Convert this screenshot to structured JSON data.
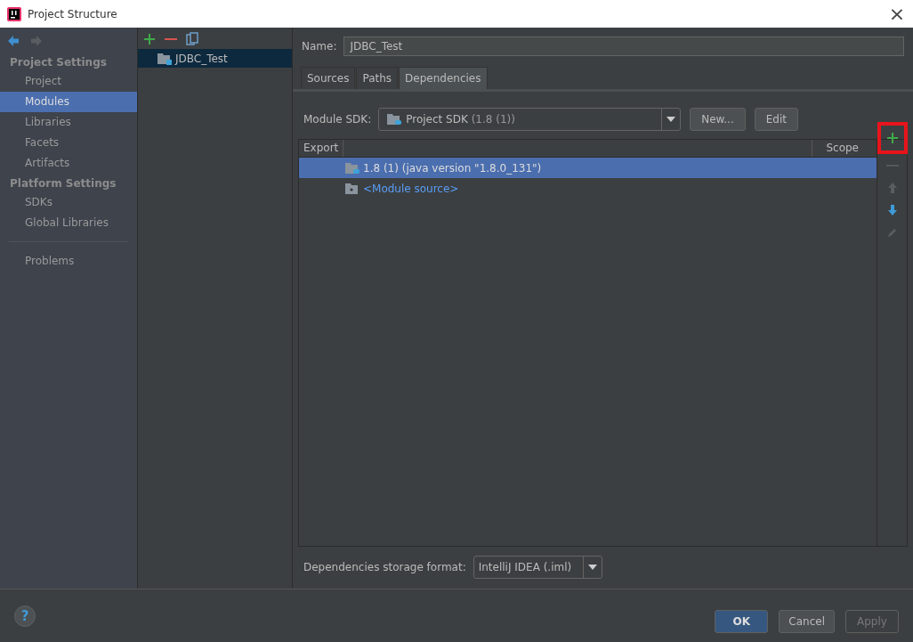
{
  "window": {
    "title": "Project Structure",
    "close": "×"
  },
  "sidebar": {
    "sections": [
      {
        "title": "Project Settings",
        "items": [
          {
            "label": "Project",
            "selected": false
          },
          {
            "label": "Modules",
            "selected": true
          },
          {
            "label": "Libraries",
            "selected": false
          },
          {
            "label": "Facets",
            "selected": false
          },
          {
            "label": "Artifacts",
            "selected": false
          }
        ]
      },
      {
        "title": "Platform Settings",
        "items": [
          {
            "label": "SDKs",
            "selected": false
          },
          {
            "label": "Global Libraries",
            "selected": false
          }
        ]
      }
    ],
    "footer_items": [
      {
        "label": "Problems",
        "selected": false
      }
    ]
  },
  "modules": {
    "items": [
      {
        "label": "JDBC_Test",
        "selected": true
      }
    ]
  },
  "name_field": {
    "label": "Name:",
    "value": "JDBC_Test"
  },
  "tabs": [
    {
      "label": "Sources",
      "selected": false
    },
    {
      "label": "Paths",
      "selected": false
    },
    {
      "label": "Dependencies",
      "selected": true
    }
  ],
  "module_sdk": {
    "label": "Module SDK:",
    "value": "Project SDK",
    "detail": "(1.8 (1))",
    "buttons": [
      "New...",
      "Edit"
    ]
  },
  "table": {
    "columns": [
      "Export",
      "Scope"
    ],
    "rows": [
      {
        "kind": "sdk",
        "label": "1.8 (1) (java version \"1.8.0_131\")",
        "selected": true
      },
      {
        "kind": "source",
        "label": "<Module source>",
        "selected": false
      }
    ]
  },
  "table_toolbar": [
    {
      "kind": "add",
      "disabled": false,
      "highlighted": true
    },
    {
      "kind": "remove",
      "disabled": true,
      "highlighted": false
    },
    {
      "kind": "up",
      "disabled": true,
      "highlighted": false
    },
    {
      "kind": "down",
      "disabled": false,
      "highlighted": false
    },
    {
      "kind": "edit",
      "disabled": true,
      "highlighted": false
    }
  ],
  "storage_format": {
    "label": "Dependencies storage format:",
    "value": "IntelliJ IDEA (.iml)"
  },
  "footer_buttons": [
    {
      "label": "OK",
      "kind": "default",
      "disabled": false
    },
    {
      "label": "Cancel",
      "kind": "normal",
      "disabled": false
    },
    {
      "label": "Apply",
      "kind": "normal",
      "disabled": true
    }
  ],
  "help": "?"
}
